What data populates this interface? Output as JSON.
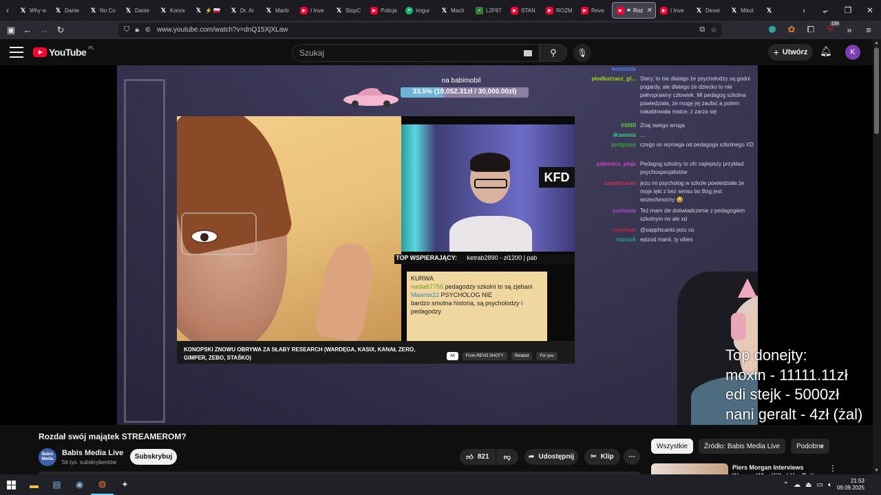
{
  "browser": {
    "tabs": [
      {
        "label": "Why w",
        "icon": "x"
      },
      {
        "label": "Danie",
        "icon": "x"
      },
      {
        "label": "No Co",
        "icon": "x"
      },
      {
        "label": "Danie",
        "icon": "x"
      },
      {
        "label": "Konra",
        "icon": "x"
      },
      {
        "label": "⚡ 🇵🇱",
        "icon": "x"
      },
      {
        "label": "Dr. Ar",
        "icon": "x"
      },
      {
        "label": "Martir",
        "icon": "x"
      },
      {
        "label": "I Inve",
        "icon": "yt"
      },
      {
        "label": "StopC",
        "icon": "x"
      },
      {
        "label": "Policja",
        "icon": "yt"
      },
      {
        "label": "Imgur",
        "icon": "img"
      },
      {
        "label": "Mach",
        "icon": "x"
      },
      {
        "label": "L2F87",
        "icon": "other"
      },
      {
        "label": "STAN",
        "icon": "yt"
      },
      {
        "label": "ROZM",
        "icon": "yt"
      },
      {
        "label": "Revo",
        "icon": "yt"
      },
      {
        "label": "Roz",
        "icon": "yt",
        "active": true
      },
      {
        "label": "I Inve",
        "icon": "yt"
      },
      {
        "label": "Dexer",
        "icon": "x"
      },
      {
        "label": "Mikol",
        "icon": "x"
      },
      {
        "label": "",
        "icon": "x"
      }
    ],
    "url": "www.youtube.com/watch?v=dnQ15XjXLaw",
    "badge_count": "198"
  },
  "youtube": {
    "logo_text": "YouTube",
    "country": "PL",
    "search_placeholder": "Szukaj",
    "create_label": "Utwórz",
    "avatar_letter": "K"
  },
  "stream": {
    "goal_title": "na babimobil",
    "goal_progress_text": "33.5% (10,052.31zł / 30,000.00zł)",
    "goal_progress": 0.335,
    "supporters_label": "TOP WSPIERAJĄCY:",
    "supporters_value": "ketrab2890 - zł1200 |    pab",
    "inner_chat": [
      {
        "user": "",
        "text": "KURWA"
      },
      {
        "user": "nadia67756",
        "text": "pedagodzy szkolni to są zjebani"
      },
      {
        "user": "Masmix22",
        "text": "PSYCHOLOG NIE"
      },
      {
        "user": "",
        "text": "bardzo smutna historia, są psycholodzy i pedagodzy"
      }
    ],
    "inner_video_title": "KONOPSKI ZNOWU OBRYWA ZA SŁABY RESEARCH (WARDĘGA, KASIX, KANAŁ ZERO, GIMPER, ZEBO, STAŚKO)",
    "inner_chips": [
      "All",
      "From REVO SHOTY",
      "Related",
      "For you"
    ],
    "chat": [
      {
        "name": "korozmix",
        "color": "#4a8cff",
        "msg": " "
      },
      {
        "name": "plodkurzacz_gl...",
        "color": "#a0e000",
        "msg": "Stary, to nie dlatego że psycholodzy są godni pogardy, ale dlatego że dziecko to nie pełnoprawny człowiek. Mi pedagog szkolna powiedziała, że mogę jej zaufać a potem nakablowała matce, z zarza się"
      },
      {
        "name": "V00RI",
        "color": "#66cc33",
        "msg": "Znaj swego wroga"
      },
      {
        "name": "iKamista",
        "color": "#3bcf8a",
        "msg": "..."
      },
      {
        "name": "justgrzeg",
        "color": "#33aa33",
        "msg": "czego on wymaga od pedagoga szkolnego XD"
      },
      {
        "name": "patelnica_plaja",
        "color": "#cc44cc",
        "msg": "Pedagog szkolny to ofc najlepszy przykład psychospecjalistów"
      },
      {
        "name": "sapphicants",
        "color": "#cc3355",
        "msg": "jezu mi psycholog w szkole powiedziała że moje lęki z bez sensu bo Bóg jest wszechmocny 😂"
      },
      {
        "name": "zochosia",
        "color": "#b04cd8",
        "msg": "Też mam złe doświadczenie z pedagogiem szkolnym no ale xd"
      },
      {
        "name": "yourbear",
        "color": "#cc2244",
        "msg": "@sapphicants jezu co"
      },
      {
        "name": "razruck",
        "color": "#22aa88",
        "msg": "epizod manii, ty vibes"
      }
    ],
    "donates_title": "Top donejty:",
    "donates": [
      "moxin - 11111.11zł",
      "edi stejk - 5000zł",
      "nani geralt - 4zł (żal)"
    ]
  },
  "video": {
    "title": "Rozdał swój majątek STREAMEROM?",
    "channel_avatar_text": "Babis Media",
    "channel": "Babis Media Live",
    "subscribers": "56 tys. subskrybentów",
    "subscribe_label": "Subskrybuj",
    "likes": "821",
    "share_label": "Udostępnij",
    "clip_label": "Klip"
  },
  "sidebar": {
    "chips": [
      "Wszystkie",
      "Źródło: Babis Media Live",
      "Podobne"
    ],
    "rec_title": "Piers Morgan Interviews Woman Who Killed Her Entire"
  },
  "taskbar": {
    "time": "21:53",
    "date": "09.09.2025"
  }
}
